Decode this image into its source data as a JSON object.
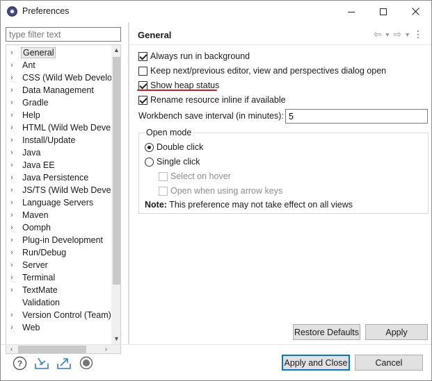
{
  "window": {
    "title": "Preferences"
  },
  "filter": {
    "placeholder": "type filter text"
  },
  "tree": {
    "items": [
      {
        "label": "General",
        "expandable": true,
        "selected": true
      },
      {
        "label": "Ant",
        "expandable": true
      },
      {
        "label": "CSS (Wild Web Develop",
        "expandable": true
      },
      {
        "label": "Data Management",
        "expandable": true
      },
      {
        "label": "Gradle",
        "expandable": true
      },
      {
        "label": "Help",
        "expandable": true
      },
      {
        "label": "HTML (Wild Web Develc",
        "expandable": true
      },
      {
        "label": "Install/Update",
        "expandable": true
      },
      {
        "label": "Java",
        "expandable": true
      },
      {
        "label": "Java EE",
        "expandable": true
      },
      {
        "label": "Java Persistence",
        "expandable": true
      },
      {
        "label": "JS/TS (Wild Web Develc",
        "expandable": true
      },
      {
        "label": "Language Servers",
        "expandable": true
      },
      {
        "label": "Maven",
        "expandable": true
      },
      {
        "label": "Oomph",
        "expandable": true
      },
      {
        "label": "Plug-in Development",
        "expandable": true
      },
      {
        "label": "Run/Debug",
        "expandable": true
      },
      {
        "label": "Server",
        "expandable": true
      },
      {
        "label": "Terminal",
        "expandable": true
      },
      {
        "label": "TextMate",
        "expandable": true
      },
      {
        "label": "Validation",
        "expandable": false
      },
      {
        "label": "Version Control (Team)",
        "expandable": true
      },
      {
        "label": "Web",
        "expandable": true
      }
    ]
  },
  "page": {
    "title": "General",
    "options": {
      "always_run_background": "Always run in background",
      "keep_next_previous": "Keep next/previous editor, view and perspectives dialog open",
      "show_heap_status": "Show heap status",
      "rename_inline": "Rename resource inline if available"
    },
    "save_interval_label": "Workbench save interval (in minutes):",
    "save_interval_value": "5",
    "open_mode": {
      "label": "Open mode",
      "double_click": "Double click",
      "single_click": "Single click",
      "select_on_hover": "Select on hover",
      "open_arrow_keys": "Open when using arrow keys"
    },
    "note_label": "Note:",
    "note_text": " This preference may not take effect on all views",
    "restore_defaults": "Restore Defaults",
    "apply": "Apply"
  },
  "footer": {
    "apply_and_close": "Apply and Close",
    "cancel": "Cancel"
  },
  "colors": {
    "highlight_underline": "#e0161b",
    "default_button_border": "#0078d7",
    "toolbar_icon_blue": "#2f7fc0"
  }
}
